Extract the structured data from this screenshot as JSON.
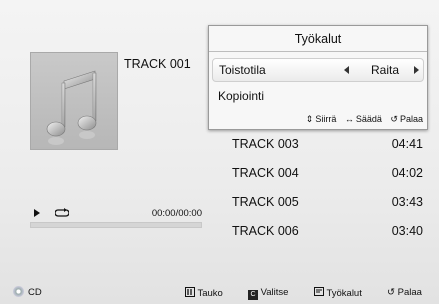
{
  "now_playing": {
    "title": "TRACK 001",
    "time": "00:00/00:00",
    "progress": 0
  },
  "playlist": [
    {
      "name": "TRACK 003",
      "duration": "04:41"
    },
    {
      "name": "TRACK 004",
      "duration": "04:02"
    },
    {
      "name": "TRACK 005",
      "duration": "03:43"
    },
    {
      "name": "TRACK 006",
      "duration": "03:40"
    }
  ],
  "tools": {
    "title": "Työkalut",
    "mode_label": "Toistotila",
    "mode_value": "Raita",
    "copy_label": "Kopiointi",
    "hint_move": "Siirrä",
    "hint_adjust": "Säädä",
    "hint_back": "Palaa"
  },
  "footer": {
    "source": "CD",
    "pause": "Tauko",
    "select": "Valitse",
    "tools": "Työkalut",
    "back": "Palaa"
  },
  "icons": [
    "music-note-icon",
    "play-icon",
    "repeat-icon",
    "cd-icon",
    "pause-icon",
    "yellow-button-icon",
    "tools-icon",
    "return-icon",
    "updown-icon",
    "leftright-icon"
  ]
}
